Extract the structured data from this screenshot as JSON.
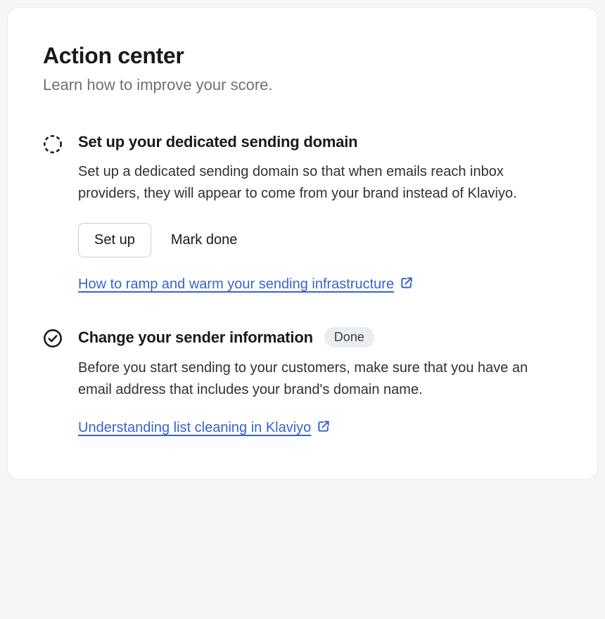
{
  "header": {
    "title": "Action center",
    "subtitle": "Learn how to improve your score."
  },
  "items": [
    {
      "title": "Set up your dedicated sending domain",
      "description": "Set up a dedicated sending domain so that when emails reach inbox providers, they will appear to come from your brand instead of Klaviyo.",
      "primary_button": "Set up",
      "secondary_button": "Mark done",
      "link_text": "How to ramp and warm your sending infrastructure"
    },
    {
      "title": "Change your sender information",
      "badge": "Done",
      "description": "Before you start sending to your customers, make sure that you have an email address that includes your brand's domain name.",
      "link_text": "Understanding list cleaning in Klaviyo"
    }
  ],
  "colors": {
    "link": "#3a63c9"
  }
}
